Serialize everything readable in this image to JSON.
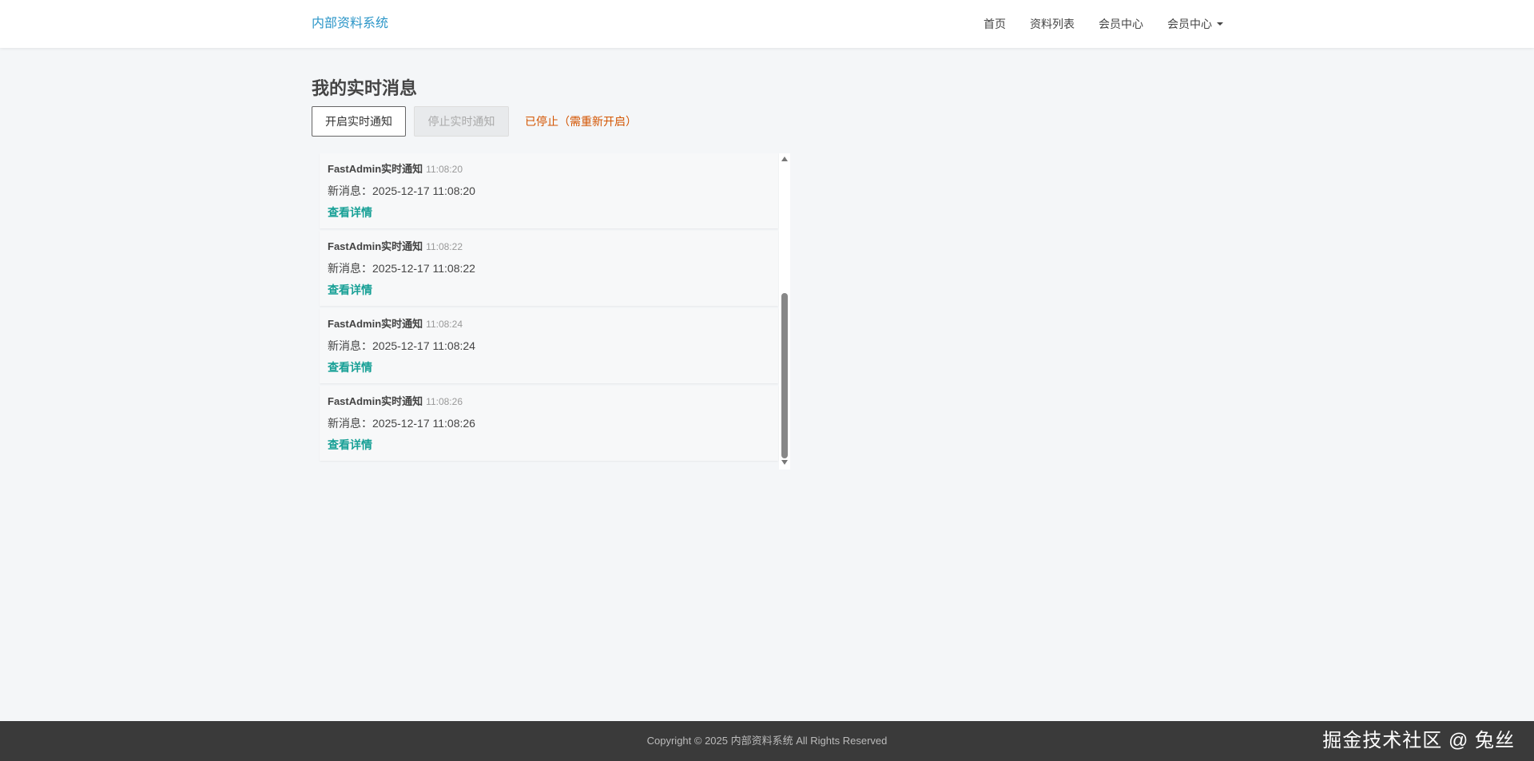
{
  "navbar": {
    "brand": "内部资料系统",
    "items": [
      {
        "label": "首页"
      },
      {
        "label": "资料列表"
      },
      {
        "label": "会员中心"
      },
      {
        "label": "会员中心"
      }
    ]
  },
  "page": {
    "title": "我的实时消息",
    "start_button": "开启实时通知",
    "stop_button": "停止实时通知",
    "status": "已停止（需重新开启）"
  },
  "messages": [
    {
      "title": "FastAdmin实时通知",
      "time": "11:08:20",
      "body": "新消息：2025-12-17 11:08:20",
      "link": "查看详情"
    },
    {
      "title": "FastAdmin实时通知",
      "time": "11:08:22",
      "body": "新消息：2025-12-17 11:08:22",
      "link": "查看详情"
    },
    {
      "title": "FastAdmin实时通知",
      "time": "11:08:24",
      "body": "新消息：2025-12-17 11:08:24",
      "link": "查看详情"
    },
    {
      "title": "FastAdmin实时通知",
      "time": "11:08:26",
      "body": "新消息：2025-12-17 11:08:26",
      "link": "查看详情"
    }
  ],
  "footer": {
    "copyright": "Copyright © 2025 内部资料系统 All Rights Reserved",
    "watermark": "掘金技术社区 @ 兔丝"
  },
  "colors": {
    "brand": "#2c96c8",
    "status": "#d35400",
    "link": "#18a096",
    "footer_bg": "#3a3a3a",
    "page_bg": "#f4f6f8"
  },
  "icons": {
    "dropdown": "caret-down-icon",
    "scroll_up": "scroll-up-arrow-icon",
    "scroll_down": "scroll-down-arrow-icon"
  }
}
